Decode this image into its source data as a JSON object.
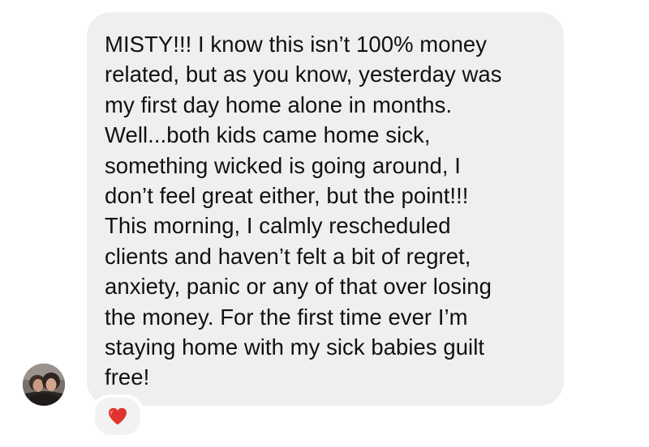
{
  "message": {
    "sender_avatar": "profile-photo-avatar",
    "lines": [
      "MISTY!!! I know this isn’t 100% money",
      "related, but as you know, yesterday was",
      "my first day home alone in months.",
      "Well...both kids came home sick,",
      "something wicked is going around, I",
      "don’t feel great either, but the point!!!",
      "This morning, I calmly rescheduled",
      "clients and haven’t felt a bit of regret,",
      "anxiety, panic or any of that over losing",
      "the money. For the first time ever I’m",
      "staying home with my sick babies guilt",
      "free!"
    ],
    "bubble_color": "#efeff0",
    "text_color": "#111111"
  },
  "reaction": {
    "icon": "red-heart-icon",
    "color": "#e0332e"
  }
}
